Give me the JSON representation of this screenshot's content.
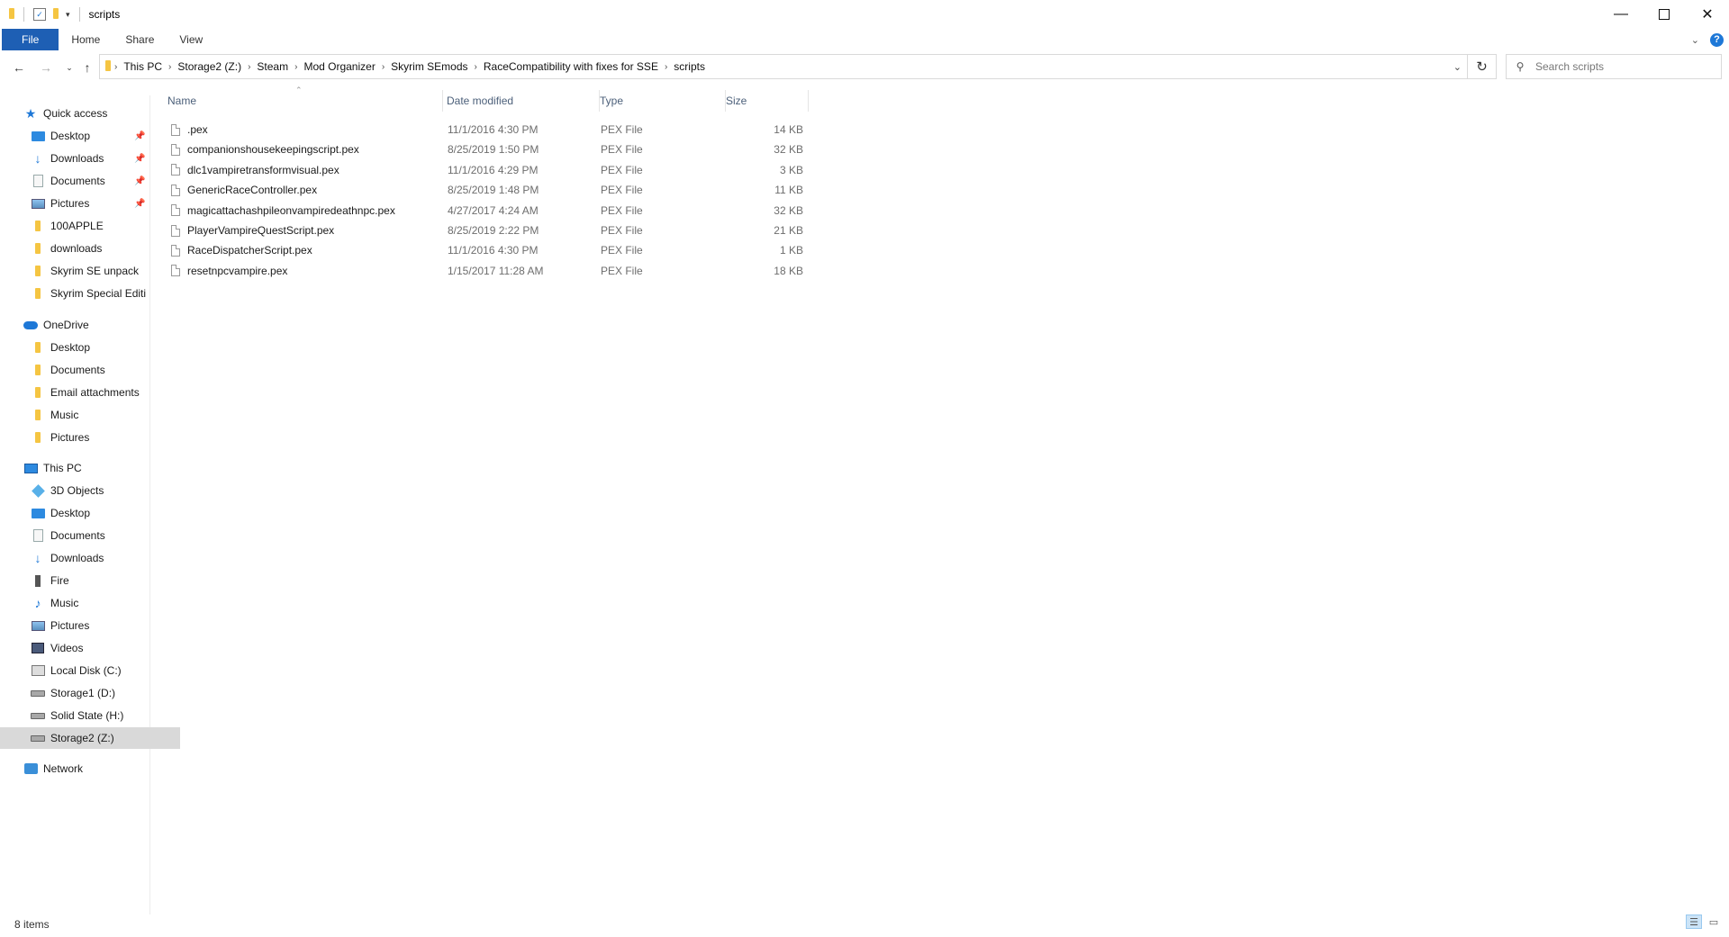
{
  "window": {
    "title": "scripts",
    "controls": [
      "minimize-icon",
      "maximize-icon",
      "close-icon"
    ]
  },
  "ribbon": {
    "tabs": [
      "File",
      "Home",
      "Share",
      "View"
    ]
  },
  "address": {
    "crumbs": [
      "This PC",
      "Storage2 (Z:)",
      "Steam",
      "Mod Organizer",
      "Skyrim SEmods",
      "RaceCompatibility with fixes for SSE",
      "scripts"
    ]
  },
  "search": {
    "placeholder": "Search scripts"
  },
  "sidebar": {
    "quick_access": {
      "label": "Quick access",
      "items": [
        {
          "label": "Desktop",
          "icon": "desktop-icon",
          "pinned": true
        },
        {
          "label": "Downloads",
          "icon": "downloads-icon",
          "pinned": true
        },
        {
          "label": "Documents",
          "icon": "documents-icon",
          "pinned": true
        },
        {
          "label": "Pictures",
          "icon": "pictures-icon",
          "pinned": true
        },
        {
          "label": "100APPLE",
          "icon": "folder-icon",
          "pinned": false
        },
        {
          "label": "downloads",
          "icon": "folder-icon",
          "pinned": false
        },
        {
          "label": "Skyrim SE unpack",
          "icon": "folder-icon",
          "pinned": false
        },
        {
          "label": "Skyrim Special Editi",
          "icon": "folder-icon",
          "pinned": false
        }
      ]
    },
    "onedrive": {
      "label": "OneDrive",
      "items": [
        {
          "label": "Desktop"
        },
        {
          "label": "Documents"
        },
        {
          "label": "Email attachments"
        },
        {
          "label": "Music"
        },
        {
          "label": "Pictures"
        }
      ]
    },
    "this_pc": {
      "label": "This PC",
      "items": [
        {
          "label": "3D Objects",
          "icon": "3d-objects-icon"
        },
        {
          "label": "Desktop",
          "icon": "desktop-icon"
        },
        {
          "label": "Documents",
          "icon": "documents-icon"
        },
        {
          "label": "Downloads",
          "icon": "downloads-icon"
        },
        {
          "label": "Fire",
          "icon": "drive-icon"
        },
        {
          "label": "Music",
          "icon": "music-icon"
        },
        {
          "label": "Pictures",
          "icon": "pictures-icon"
        },
        {
          "label": "Videos",
          "icon": "videos-icon"
        },
        {
          "label": "Local Disk (C:)",
          "icon": "local-disk-icon"
        },
        {
          "label": "Storage1 (D:)",
          "icon": "drive-icon"
        },
        {
          "label": "Solid State (H:)",
          "icon": "drive-icon"
        },
        {
          "label": "Storage2 (Z:)",
          "icon": "drive-icon",
          "selected": true
        }
      ]
    },
    "network": {
      "label": "Network"
    }
  },
  "columns": [
    "Name",
    "Date modified",
    "Type",
    "Size"
  ],
  "files": [
    {
      "name": ".pex",
      "date": "11/1/2016 4:30 PM",
      "type": "PEX File",
      "size": "14 KB"
    },
    {
      "name": "companionshousekeepingscript.pex",
      "date": "8/25/2019 1:50 PM",
      "type": "PEX File",
      "size": "32 KB"
    },
    {
      "name": "dlc1vampiretransformvisual.pex",
      "date": "11/1/2016 4:29 PM",
      "type": "PEX File",
      "size": "3 KB"
    },
    {
      "name": "GenericRaceController.pex",
      "date": "8/25/2019 1:48 PM",
      "type": "PEX File",
      "size": "11 KB"
    },
    {
      "name": "magicattachashpileonvampiredeathnpc.pex",
      "date": "4/27/2017 4:24 AM",
      "type": "PEX File",
      "size": "32 KB"
    },
    {
      "name": "PlayerVampireQuestScript.pex",
      "date": "8/25/2019 2:22 PM",
      "type": "PEX File",
      "size": "21 KB"
    },
    {
      "name": "RaceDispatcherScript.pex",
      "date": "11/1/2016 4:30 PM",
      "type": "PEX File",
      "size": "1 KB"
    },
    {
      "name": "resetnpcvampire.pex",
      "date": "1/15/2017 11:28 AM",
      "type": "PEX File",
      "size": "18 KB"
    }
  ],
  "status": {
    "item_count": "8 items"
  },
  "colors": {
    "file_tab": "#1e5fb4",
    "selected_nav": "#d9d9d9",
    "header_text": "#4c607a"
  }
}
